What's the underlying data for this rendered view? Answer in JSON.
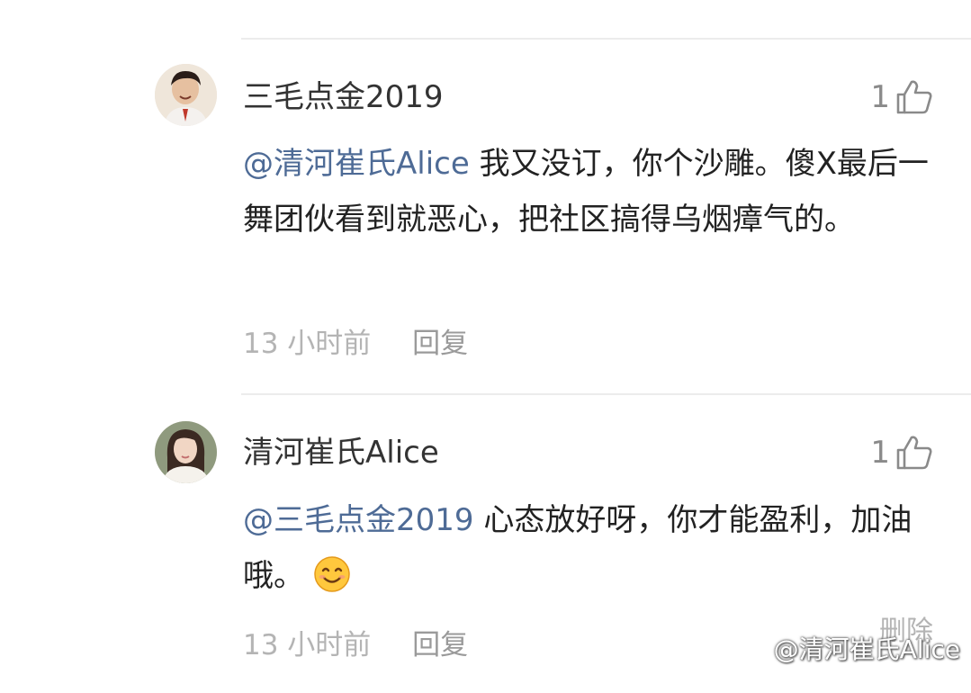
{
  "comments": [
    {
      "username": "三毛点金2019",
      "like_count": "1",
      "mention": "@清河崔氏Alice",
      "text": " 我又没订，你个沙雕。傻X最后一舞团伙看到就恶心，把社区搞得乌烟瘴气的。",
      "time": "13 小时前",
      "reply_label": "回复",
      "avatar_icon": "male-user-avatar"
    },
    {
      "username": "清河崔氏Alice",
      "like_count": "1",
      "mention": "@三毛点金2019",
      "text": " 心态放好呀，你才能盈利，加油哦。",
      "emoji": "smiling-face-emoji",
      "time": "13 小时前",
      "reply_label": "回复",
      "delete_label": "删除",
      "avatar_icon": "female-user-avatar"
    }
  ],
  "watermark": {
    "text": "@清河崔氏Alice",
    "icon": "weibo-icon"
  },
  "colors": {
    "mention": "#4e6b96",
    "meta": "#b4b4b4",
    "divider": "#ececec"
  }
}
